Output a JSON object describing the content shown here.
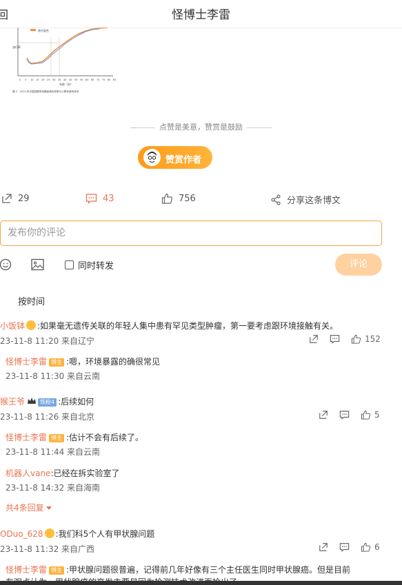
{
  "header": {
    "back_glyph": "回",
    "title": "怪博士李雷"
  },
  "figure": {
    "legend": "农村女性",
    "x_label": "年龄（岁）",
    "x_ticks": [
      "0",
      "5",
      "10",
      "15",
      "20",
      "25",
      "30",
      "35",
      "40",
      "45",
      "50",
      "55",
      "60",
      "65",
      "70",
      "75",
      "80",
      "85"
    ],
    "caption": "图 2　2015 年中国进展甲状腺疾病负担率与人群年龄的关系"
  },
  "likes_hint": "点赞是美意，赞赏是鼓励",
  "reward": {
    "label": "赞赏作者"
  },
  "actions": {
    "repost_count": "29",
    "comment_count": "43",
    "like_count": "756",
    "share_label": "分享这条博文"
  },
  "composer": {
    "placeholder": "发布你的评论",
    "repost_label": "同时转发",
    "submit_label": "评论"
  },
  "sort_label": "按时间",
  "comments": [
    {
      "user": "小饭钵",
      "text": ":如果毫无遗传关联的年轻人集中患有罕见类型肿瘤，第一要考虑跟环境接触有关。",
      "meta": "23-11-8 11:20 来自辽宁",
      "likes": "152",
      "replies": [
        {
          "user": "怪博士李雷",
          "badge": "博主",
          "text": ":嗯，环境暴露的确很常见",
          "meta": "23-11-8 11:30 来自云南"
        }
      ]
    },
    {
      "user": "猴王爷",
      "badge": "铁粉4",
      "text": ":后续如何",
      "meta": "23-11-8 11:26 来自北京",
      "likes": "5",
      "replies": [
        {
          "user": "怪博士李雷",
          "badge": "博主",
          "text": ":估计不会有后续了。",
          "meta": "23-11-8 11:44 来自云南"
        },
        {
          "user": "机器人vane",
          "text": ":已经在拆实验室了",
          "meta": "23-11-8 14:32 来自海南"
        }
      ],
      "more": "共4条回复"
    },
    {
      "user": "ODuo_628",
      "text": ":我们科5个人有甲状腺问题",
      "meta": "23-11-8 11:32 来自广西",
      "likes": "6",
      "replies": [
        {
          "user": "怪博士李雷",
          "badge": "博主",
          "text": ":甲状腺问题很普遍，记得前几年好像有三个主任医生同时甲状腺癌。但是目前",
          "text2": "有观点认为，甲状腺癌的高发主要是因为检测技术改进而检出了",
          "meta": ""
        }
      ]
    }
  ]
}
